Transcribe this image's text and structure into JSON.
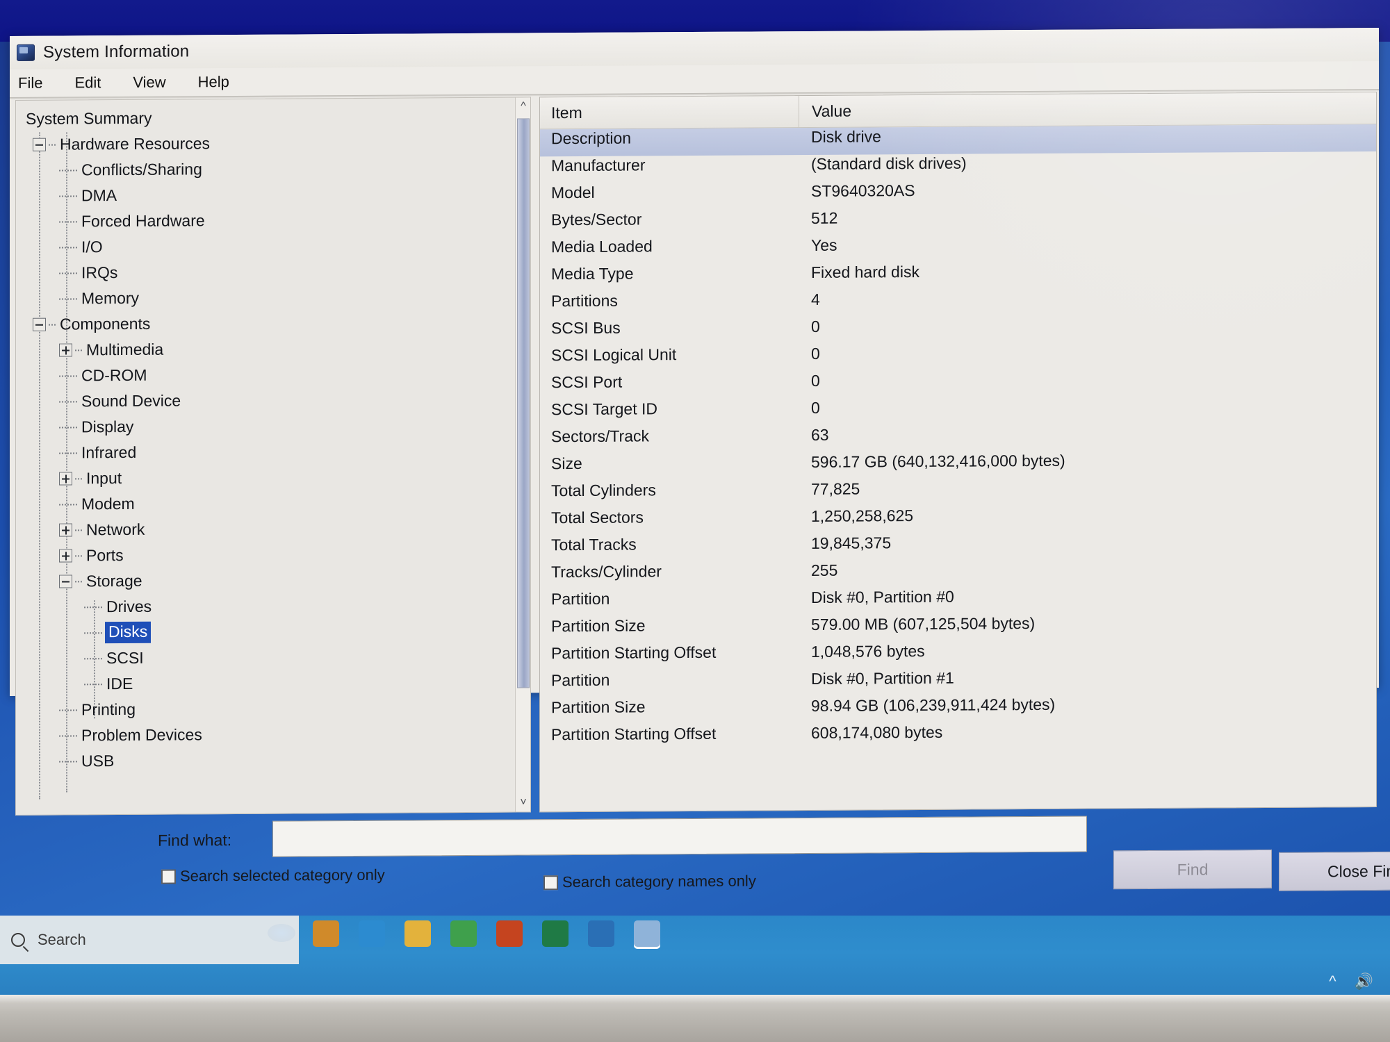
{
  "window": {
    "title": "System Information",
    "icon": "system-information-icon",
    "menu": [
      "File",
      "Edit",
      "View",
      "Help"
    ]
  },
  "tree": {
    "nodes": [
      {
        "label": "System Summary",
        "level": 0,
        "toggle": "none",
        "selected": false
      },
      {
        "label": "Hardware Resources",
        "level": 1,
        "toggle": "minus",
        "selected": false
      },
      {
        "label": "Conflicts/Sharing",
        "level": 2,
        "toggle": "leaf",
        "selected": false
      },
      {
        "label": "DMA",
        "level": 2,
        "toggle": "leaf",
        "selected": false
      },
      {
        "label": "Forced Hardware",
        "level": 2,
        "toggle": "leaf",
        "selected": false
      },
      {
        "label": "I/O",
        "level": 2,
        "toggle": "leaf",
        "selected": false
      },
      {
        "label": "IRQs",
        "level": 2,
        "toggle": "leaf",
        "selected": false
      },
      {
        "label": "Memory",
        "level": 2,
        "toggle": "leaf",
        "selected": false
      },
      {
        "label": "Components",
        "level": 1,
        "toggle": "minus",
        "selected": false
      },
      {
        "label": "Multimedia",
        "level": 2,
        "toggle": "plus",
        "selected": false
      },
      {
        "label": "CD-ROM",
        "level": 2,
        "toggle": "leaf",
        "selected": false
      },
      {
        "label": "Sound Device",
        "level": 2,
        "toggle": "leaf",
        "selected": false
      },
      {
        "label": "Display",
        "level": 2,
        "toggle": "leaf",
        "selected": false
      },
      {
        "label": "Infrared",
        "level": 2,
        "toggle": "leaf",
        "selected": false
      },
      {
        "label": "Input",
        "level": 2,
        "toggle": "plus",
        "selected": false
      },
      {
        "label": "Modem",
        "level": 2,
        "toggle": "leaf",
        "selected": false
      },
      {
        "label": "Network",
        "level": 2,
        "toggle": "plus",
        "selected": false
      },
      {
        "label": "Ports",
        "level": 2,
        "toggle": "plus",
        "selected": false
      },
      {
        "label": "Storage",
        "level": 2,
        "toggle": "minus",
        "selected": false
      },
      {
        "label": "Drives",
        "level": 3,
        "toggle": "leaf",
        "selected": false
      },
      {
        "label": "Disks",
        "level": 3,
        "toggle": "leaf",
        "selected": true
      },
      {
        "label": "SCSI",
        "level": 3,
        "toggle": "leaf",
        "selected": false
      },
      {
        "label": "IDE",
        "level": 3,
        "toggle": "leaf",
        "selected": false
      },
      {
        "label": "Printing",
        "level": 2,
        "toggle": "leaf",
        "selected": false
      },
      {
        "label": "Problem Devices",
        "level": 2,
        "toggle": "leaf",
        "selected": false
      },
      {
        "label": "USB",
        "level": 2,
        "toggle": "leaf",
        "selected": false
      }
    ]
  },
  "detail": {
    "columns": [
      "Item",
      "Value"
    ],
    "rows": [
      {
        "item": "Description",
        "value": "Disk drive",
        "selected": true
      },
      {
        "item": "Manufacturer",
        "value": "(Standard disk drives)",
        "selected": false
      },
      {
        "item": "Model",
        "value": "ST9640320AS",
        "selected": false
      },
      {
        "item": "Bytes/Sector",
        "value": "512",
        "selected": false
      },
      {
        "item": "Media Loaded",
        "value": "Yes",
        "selected": false
      },
      {
        "item": "Media Type",
        "value": "Fixed hard disk",
        "selected": false
      },
      {
        "item": "Partitions",
        "value": "4",
        "selected": false
      },
      {
        "item": "SCSI Bus",
        "value": "0",
        "selected": false
      },
      {
        "item": "SCSI Logical Unit",
        "value": "0",
        "selected": false
      },
      {
        "item": "SCSI Port",
        "value": "0",
        "selected": false
      },
      {
        "item": "SCSI Target ID",
        "value": "0",
        "selected": false
      },
      {
        "item": "Sectors/Track",
        "value": "63",
        "selected": false
      },
      {
        "item": "Size",
        "value": "596.17 GB (640,132,416,000 bytes)",
        "selected": false
      },
      {
        "item": "Total Cylinders",
        "value": "77,825",
        "selected": false
      },
      {
        "item": "Total Sectors",
        "value": "1,250,258,625",
        "selected": false
      },
      {
        "item": "Total Tracks",
        "value": "19,845,375",
        "selected": false
      },
      {
        "item": "Tracks/Cylinder",
        "value": "255",
        "selected": false
      },
      {
        "item": "Partition",
        "value": "Disk #0, Partition #0",
        "selected": false
      },
      {
        "item": "Partition Size",
        "value": "579.00 MB (607,125,504 bytes)",
        "selected": false
      },
      {
        "item": "Partition Starting Offset",
        "value": "1,048,576 bytes",
        "selected": false
      },
      {
        "item": "Partition",
        "value": "Disk #0, Partition #1",
        "selected": false
      },
      {
        "item": "Partition Size",
        "value": "98.94 GB (106,239,911,424 bytes)",
        "selected": false
      },
      {
        "item": "Partition Starting Offset",
        "value": "608,174,080 bytes",
        "selected": false
      }
    ]
  },
  "find": {
    "label": "Find what:",
    "input_value": "",
    "input_placeholder": "",
    "checkbox_selected_category": "Search selected category only",
    "checkbox_category_names": "Search category names only",
    "find_button": "Find",
    "close_button": "Close Find"
  },
  "taskbar": {
    "search_placeholder": "Search",
    "icons": [
      {
        "name": "store-icon",
        "color": "#d08a2a"
      },
      {
        "name": "edge-icon",
        "color": "#2c8bd0"
      },
      {
        "name": "file-explorer-icon",
        "color": "#e3b23c"
      },
      {
        "name": "chrome-icon",
        "color": "#3fa04c"
      },
      {
        "name": "powerpoint-icon",
        "color": "#c5441f"
      },
      {
        "name": "excel-icon",
        "color": "#1f7a45"
      },
      {
        "name": "photos-icon",
        "color": "#2a6fb5"
      },
      {
        "name": "system-information-icon",
        "color": "#8fb3d9"
      }
    ],
    "tray": [
      "^",
      "volume-icon"
    ]
  },
  "colors": {
    "selection_blue": "#1f4fb8",
    "row_selection": "#bcc5de",
    "window_bg": "#eceae6",
    "desktop_blue": "#1d4fae"
  }
}
